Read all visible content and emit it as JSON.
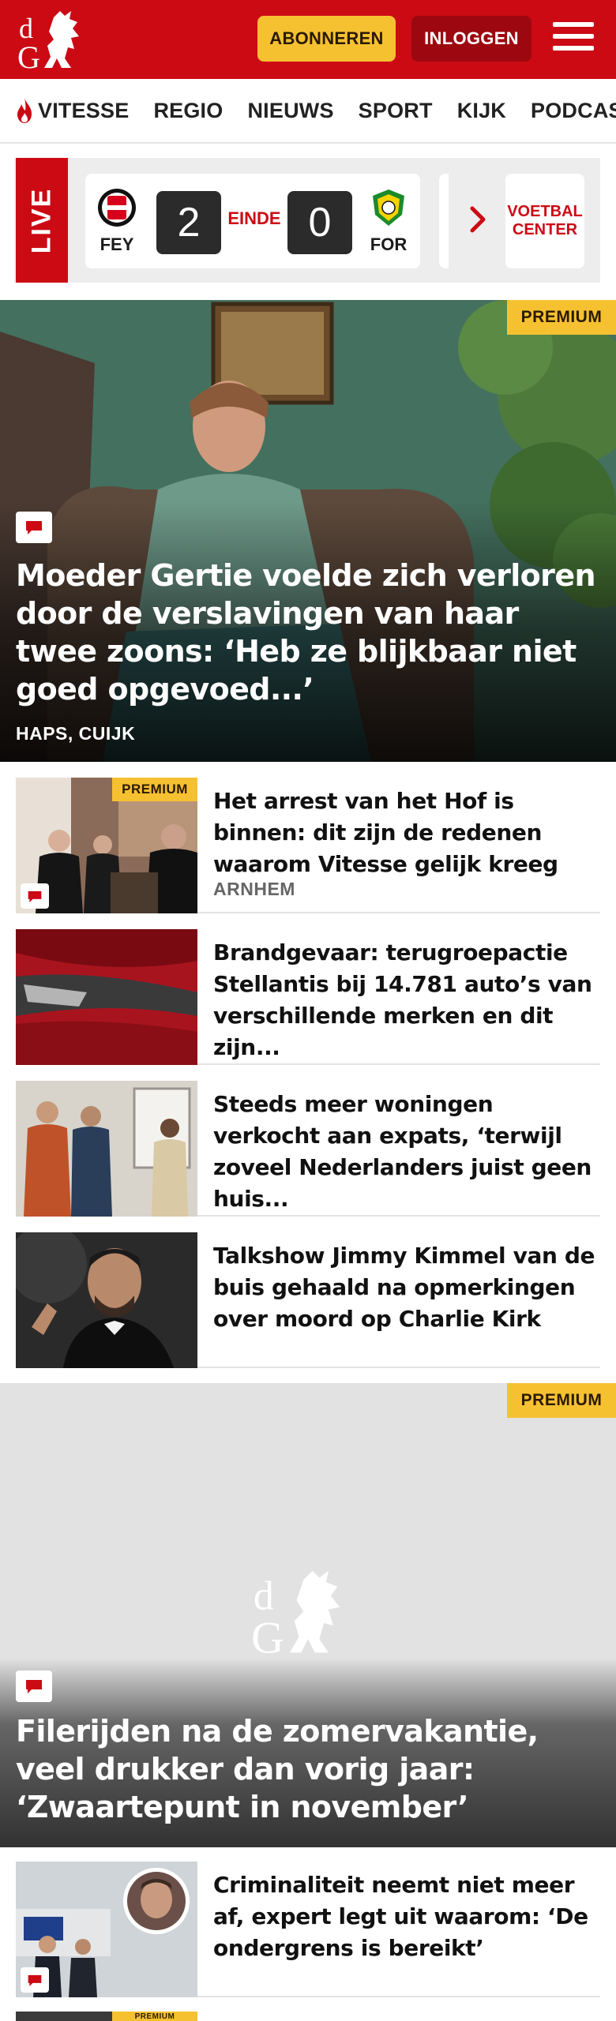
{
  "header": {
    "brand_color": "#cc0a14",
    "logo_letters": "dG",
    "subscribe_label": "ABONNEREN",
    "login_label": "INLOGGEN"
  },
  "nav": {
    "items": [
      {
        "label": "VITESSE",
        "icon": "flame-icon"
      },
      {
        "label": "REGIO"
      },
      {
        "label": "NIEUWS"
      },
      {
        "label": "SPORT"
      },
      {
        "label": "KIJK"
      },
      {
        "label": "PODCAST"
      }
    ]
  },
  "live": {
    "tag": "LIVE",
    "match": {
      "home": "FEY",
      "home_score": "2",
      "status": "EINDE",
      "away_score": "0",
      "away": "FOR"
    },
    "voetbal_center": "VOETBAL CENTER"
  },
  "hero": {
    "premium": "PREMIUM",
    "title": "Moeder Gertie voelde zich verloren door de verslavingen van haar twee zoons: ‘Heb ze blijkbaar niet goed opgevoed...’",
    "location": "HAPS, CUIJK"
  },
  "articles": [
    {
      "premium": "PREMIUM",
      "title": "Het arrest van het Hof is binnen: dit zijn de redenen waarom Vitesse gelijk kreeg",
      "location": "ARNHEM"
    },
    {
      "title": "Brandgevaar: terugroepactie Stellantis bij 14.781 auto’s van verschillende merken en dit zijn..."
    },
    {
      "title": "Steeds meer woningen verkocht aan expats, ‘terwijl zoveel Nederlanders juist geen huis..."
    },
    {
      "title": "Talkshow Jimmy Kimmel van de buis gehaald na opmerkingen over moord op Charlie Kirk"
    }
  ],
  "feature": {
    "premium": "PREMIUM",
    "title": "Filerijden na de zomervakantie, veel drukker dan vorig jaar: ‘Zwaartepunt in november’"
  },
  "bottom_article": {
    "title": "Criminaliteit neemt niet meer af, expert legt uit waarom: ‘De ondergrens is bereikt’"
  },
  "next_article": {
    "premium": "PREMIUM"
  },
  "colors": {
    "accent_yellow": "#f6c131",
    "dark_red": "#9d0810"
  }
}
